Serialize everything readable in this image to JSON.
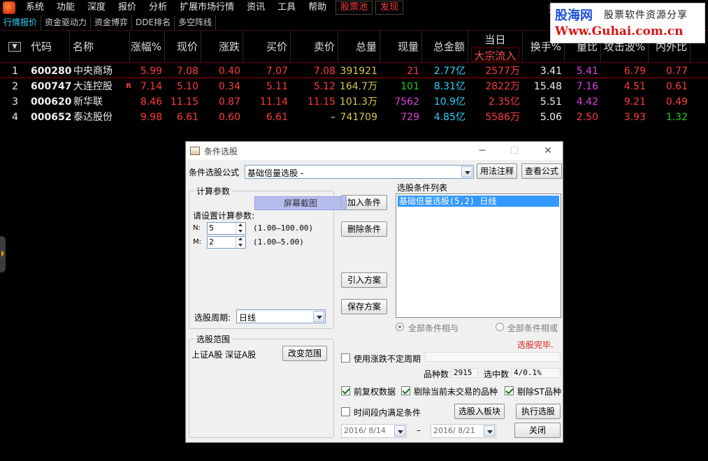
{
  "menu": [
    "系统",
    "功能",
    "深度",
    "报价",
    "分析",
    "扩展市场行情",
    "资讯",
    "工具",
    "帮助"
  ],
  "menu_highlight": [
    "股票池",
    "发现"
  ],
  "top_right_text": "交",
  "watermark": {
    "brand": "股海网",
    "slogan": "股票软件资源分享",
    "url": "Www.Guhai.com.cn"
  },
  "tabs": [
    "行情报价",
    "资金驱动力",
    "资金博弈",
    "DDE排名",
    "多空阵线"
  ],
  "columns": {
    "code": "代码",
    "name": "名称",
    "change_pct": "涨幅%",
    "price": "现价",
    "change": "涨跌",
    "bid": "买价",
    "ask": "卖价",
    "volume": "总量",
    "cur_volume": "现量",
    "amount": "总金额",
    "today": "当日",
    "block_inflow": "大宗流入",
    "turnover": "换手%",
    "vol_ratio": "量比",
    "attack": "攻击波%",
    "in_out": "内外比"
  },
  "rows": [
    {
      "idx": "1",
      "code": "600280",
      "name": "中央商场",
      "flag": "",
      "change_pct": "5.99",
      "price": "7.08",
      "change": "0.40",
      "bid": "7.07",
      "ask": "7.08",
      "volume": "391921",
      "cur_volume": "21",
      "amount": "2.77亿",
      "block_inflow": "2577万",
      "turnover": "3.41",
      "vol_ratio": "5.41",
      "attack": "6.79",
      "in_out": "0.77"
    },
    {
      "idx": "2",
      "code": "600747",
      "name": "大连控股",
      "flag": "R",
      "change_pct": "7.14",
      "price": "5.10",
      "change": "0.34",
      "bid": "5.11",
      "ask": "5.12",
      "volume": "164.7万",
      "cur_volume": "101",
      "amount": "8.31亿",
      "block_inflow": "2822万",
      "turnover": "15.48",
      "vol_ratio": "7.16",
      "attack": "4.51",
      "in_out": "0.61"
    },
    {
      "idx": "3",
      "code": "000620",
      "name": "新华联",
      "flag": "",
      "change_pct": "8.46",
      "price": "11.15",
      "change": "0.87",
      "bid": "11.14",
      "ask": "11.15",
      "volume": "101.3万",
      "cur_volume": "7562",
      "amount": "10.9亿",
      "block_inflow": "2.35亿",
      "turnover": "5.51",
      "vol_ratio": "4.42",
      "attack": "9.21",
      "in_out": "0.49"
    },
    {
      "idx": "4",
      "code": "000652",
      "name": "泰达股份",
      "flag": "",
      "change_pct": "9.98",
      "price": "6.61",
      "change": "0.60",
      "bid": "6.61",
      "ask": "–",
      "volume": "741709",
      "cur_volume": "729",
      "amount": "4.85亿",
      "block_inflow": "5586万",
      "turnover": "5.06",
      "vol_ratio": "2.50",
      "attack": "3.93",
      "in_out": "1.32"
    }
  ],
  "dialog": {
    "title": "条件选股",
    "formula_label": "条件选股公式",
    "formula_value": "基础倍量选股 -",
    "btn_usage": "用法注释",
    "btn_view": "查看公式",
    "params_group": "计算参数",
    "params_prompt": "请设置计算参数:",
    "screenshot_tag": "屏幕截图",
    "param_n_label": "N:",
    "param_n_value": "5",
    "param_n_range": "(1.00—100.00)",
    "param_m_label": "M:",
    "param_m_value": "2",
    "param_m_range": "(1.00—5.00)",
    "period_label": "选股周期:",
    "period_value": "日线",
    "btn_add": "加入条件",
    "btn_delete": "删除条件",
    "btn_import": "引入方案",
    "btn_save": "保存方案",
    "list_label": "选股条件列表",
    "list_items": [
      "基础倍量选股(5,2) 日线"
    ],
    "radio_and": "全部条件相与",
    "radio_or": "全部条件相或",
    "status": "选股完毕.",
    "range_group": "选股范围",
    "range_value": "上证A股 深证A股",
    "btn_change_range": "改变范围",
    "chk_uncertain": "使用涨跌不定周期",
    "count_label": "品种数",
    "count_value": "2915",
    "selected_label": "选中数",
    "selected_value": "4/0.1%",
    "chk_prerights": "前复权数据",
    "chk_exclude_untraded": "剔除当前未交易的品种",
    "chk_exclude_st": "剔除ST品种",
    "chk_timerange": "时间段内满足条件",
    "btn_to_block": "选股入板块",
    "btn_execute": "执行选股",
    "btn_close": "关闭",
    "date_from": "2016/ 8/14",
    "date_to": "2016/ 8/21",
    "date_sep": "–"
  }
}
